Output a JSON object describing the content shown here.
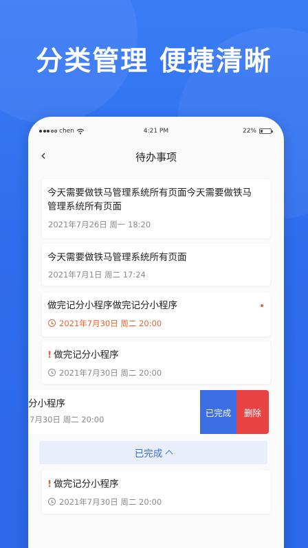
{
  "headline": "分类管理 便捷清晰",
  "status_bar": {
    "carrier": "chen",
    "time": "4:21 PM",
    "battery": "22%",
    "battery_level": 0.22
  },
  "nav": {
    "title": "待办事项"
  },
  "todos": [
    {
      "title": "今天需要做铁马管理系统所有页面今天需要做铁马管理系统所有页面",
      "date": "2021年7月26日 周一  18:20"
    },
    {
      "title": "今天需要做铁马管理系统所有页面",
      "date": "2021年7月1日 周二 17:24"
    },
    {
      "title": "做完记分小程序做完记分小程序",
      "date": "2021年7月30日 周二 20:00"
    },
    {
      "title": "做完记分小程序",
      "date": "2021年7月30日 周二 20:00"
    }
  ],
  "swiped_item": {
    "title": "分小程序",
    "date": "7月30日 周二 20:00",
    "done_label": "已完成",
    "delete_label": "删除"
  },
  "completed_section": {
    "label": "已完成"
  },
  "completed_items": [
    {
      "title": "做完记分小程序",
      "date": "2021年7月30日 周二 20:00"
    }
  ],
  "colors": {
    "primary": "#3d6de3",
    "danger": "#e94242",
    "alert": "#e8622c",
    "background": "#2f6ef2"
  }
}
